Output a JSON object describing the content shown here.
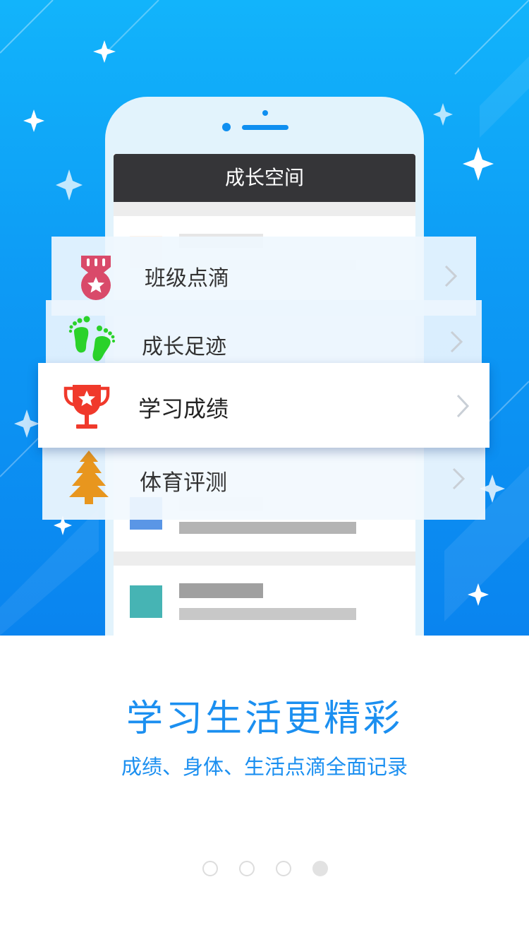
{
  "hero": {
    "phone_screen_title": "成长空间"
  },
  "menu": {
    "items": [
      {
        "label": "班级点滴",
        "icon": "medal-icon",
        "color": "#d94a6a"
      },
      {
        "label": "成长足迹",
        "icon": "footprints-icon",
        "color": "#2ad22a"
      },
      {
        "label": "学习成绩",
        "icon": "trophy-icon",
        "color": "#f0392b"
      },
      {
        "label": "体育评测",
        "icon": "tree-icon",
        "color": "#e8961e"
      }
    ]
  },
  "caption": {
    "headline": "学习生活更精彩",
    "subline": "成绩、身体、生活点滴全面记录"
  },
  "pager": {
    "page_count": 4,
    "active_index": 3
  },
  "colors": {
    "accent": "#1b8ff0",
    "hero_top": "#12b4fb",
    "hero_bottom": "#0a84ef"
  }
}
